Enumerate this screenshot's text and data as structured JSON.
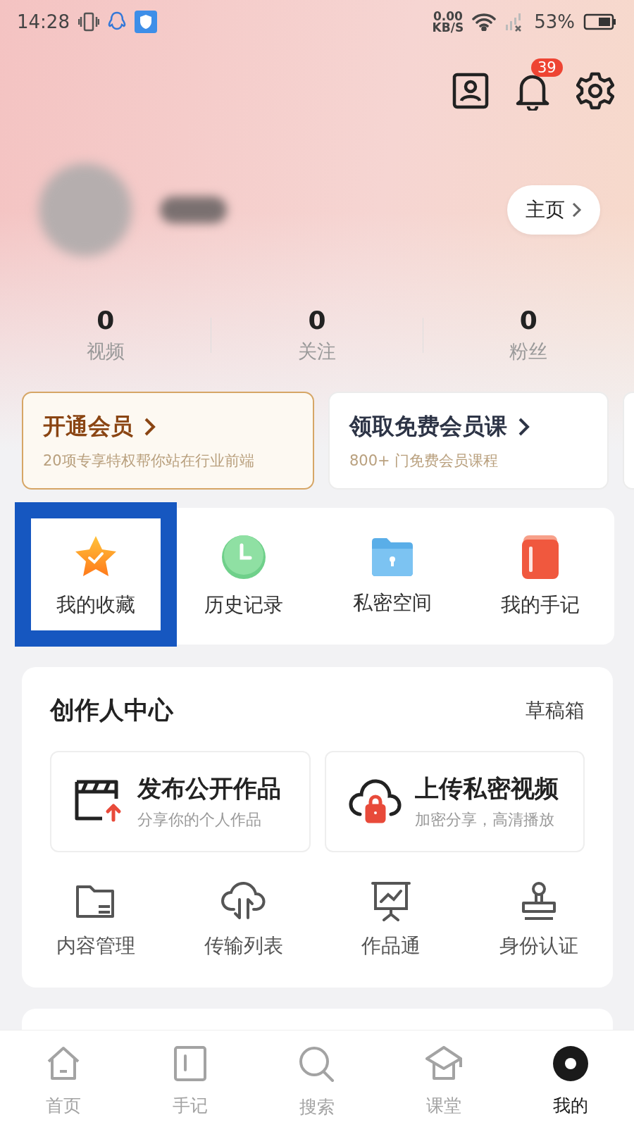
{
  "status_bar": {
    "time": "14:28",
    "net_speed": "0.00",
    "net_unit": "KB/S",
    "battery": "53%"
  },
  "header": {
    "notification_badge": "39"
  },
  "profile": {
    "home_button": "主页"
  },
  "stats": [
    {
      "value": "0",
      "label": "视频"
    },
    {
      "value": "0",
      "label": "关注"
    },
    {
      "value": "0",
      "label": "粉丝"
    }
  ],
  "member_cards": [
    {
      "kind": "vip",
      "title": "开通会员",
      "subtitle": "20项专享特权帮你站在行业前端"
    },
    {
      "kind": "course",
      "title": "领取免费会员课",
      "subtitle": "800+ 门免费会员课程"
    }
  ],
  "shortcuts": [
    {
      "label": "我的收藏",
      "highlighted": true
    },
    {
      "label": "历史记录",
      "highlighted": false
    },
    {
      "label": "私密空间",
      "highlighted": false
    },
    {
      "label": "我的手记",
      "highlighted": false
    }
  ],
  "creator_center": {
    "title": "创作人中心",
    "drafts": "草稿箱",
    "actions": [
      {
        "title": "发布公开作品",
        "subtitle": "分享你的个人作品"
      },
      {
        "title": "上传私密视频",
        "subtitle": "加密分享，高清播放"
      }
    ],
    "tools": [
      {
        "label": "内容管理"
      },
      {
        "label": "传输列表"
      },
      {
        "label": "作品通"
      },
      {
        "label": "身份认证"
      }
    ]
  },
  "tab_bar": [
    {
      "label": "首页",
      "selected": false
    },
    {
      "label": "手记",
      "selected": false
    },
    {
      "label": "搜索",
      "selected": false
    },
    {
      "label": "课堂",
      "selected": false
    },
    {
      "label": "我的",
      "selected": true
    }
  ]
}
